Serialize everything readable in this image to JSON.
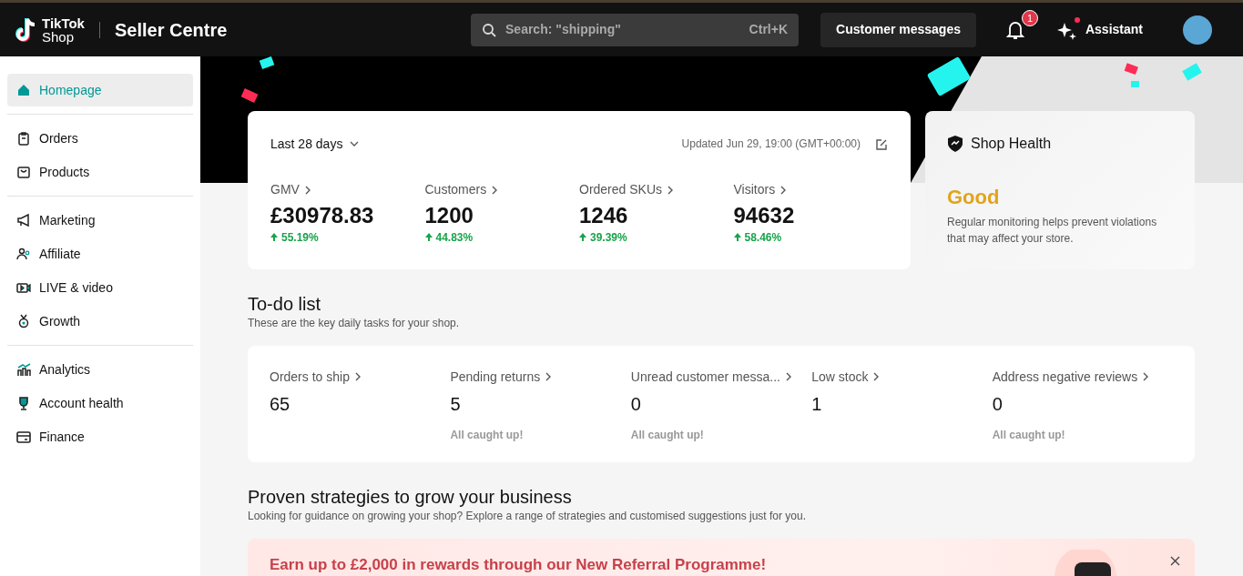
{
  "header": {
    "brand_top": "TikTok",
    "brand_bottom": "Shop",
    "title": "Seller Centre",
    "search": {
      "placeholder": "Search: \"shipping\"",
      "shortcut": "Ctrl+K"
    },
    "messages_button": "Customer messages",
    "notifications_badge": "1",
    "assistant": "Assistant",
    "assistant_dot": true
  },
  "sidebar": {
    "groups": [
      [
        {
          "label": "Homepage",
          "selected": true
        }
      ],
      [
        {
          "label": "Orders",
          "selected": false
        },
        {
          "label": "Products",
          "selected": false
        }
      ],
      [
        {
          "label": "Marketing",
          "selected": false
        },
        {
          "label": "Affiliate",
          "selected": false
        },
        {
          "label": "LIVE & video",
          "selected": false
        },
        {
          "label": "Growth",
          "selected": false
        }
      ],
      [
        {
          "label": "Analytics",
          "selected": false
        },
        {
          "label": "Account health",
          "selected": false
        },
        {
          "label": "Finance",
          "selected": false
        }
      ]
    ]
  },
  "stats": {
    "period": "Last 28 days",
    "updated": "Updated Jun 29, 19:00 (GMT+00:00)",
    "metrics": [
      {
        "label": "GMV",
        "value": "£30978.83",
        "change": "55.19%"
      },
      {
        "label": "Customers",
        "value": "1200",
        "change": "44.83%"
      },
      {
        "label": "Ordered SKUs",
        "value": "1246",
        "change": "39.39%"
      },
      {
        "label": "Visitors",
        "value": "94632",
        "change": "58.46%"
      }
    ]
  },
  "shop_health": {
    "title": "Shop Health",
    "status": "Good",
    "description": "Regular monitoring helps prevent violations that may affect your store."
  },
  "todo": {
    "title": "To-do list",
    "subtitle": "These are the key daily tasks for your shop.",
    "items": [
      {
        "label": "Orders to ship",
        "value": "65"
      },
      {
        "label": "Pending returns",
        "value": "5",
        "note": "All caught up!"
      },
      {
        "label": "Unread customer messa...",
        "value": "0",
        "note": "All caught up!"
      },
      {
        "label": "Low stock",
        "value": "1"
      },
      {
        "label": "Address negative reviews",
        "value": "0",
        "note": "All caught up!"
      }
    ]
  },
  "strategies": {
    "title": "Proven strategies to grow your business",
    "subtitle": "Looking for guidance on growing your shop? Explore a range of strategies and customised suggestions just for you.",
    "banner_title": "Earn up to £2,000 in rewards through our New Referral Programme!"
  }
}
